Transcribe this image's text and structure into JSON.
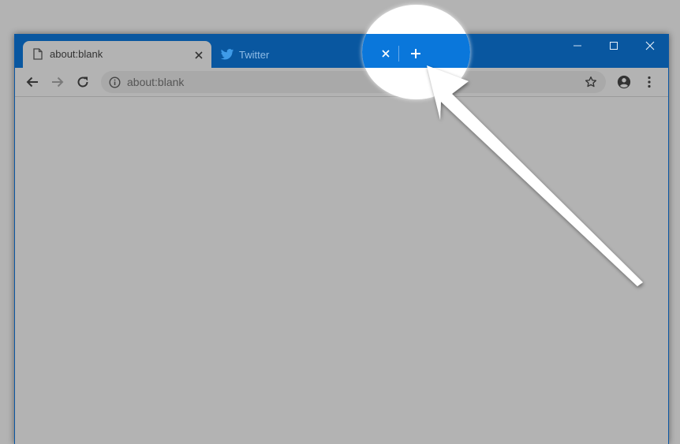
{
  "tabs": [
    {
      "title": "about:blank",
      "icon": "document-icon",
      "active": true
    },
    {
      "title": "Twitter",
      "icon": "twitter-bird-icon",
      "active": false
    }
  ],
  "omnibox": {
    "url": "about:blank"
  },
  "colors": {
    "titlebar": "#0957a0",
    "highlight_blue": "#0a77db",
    "page_gray": "#b3b3b3"
  }
}
